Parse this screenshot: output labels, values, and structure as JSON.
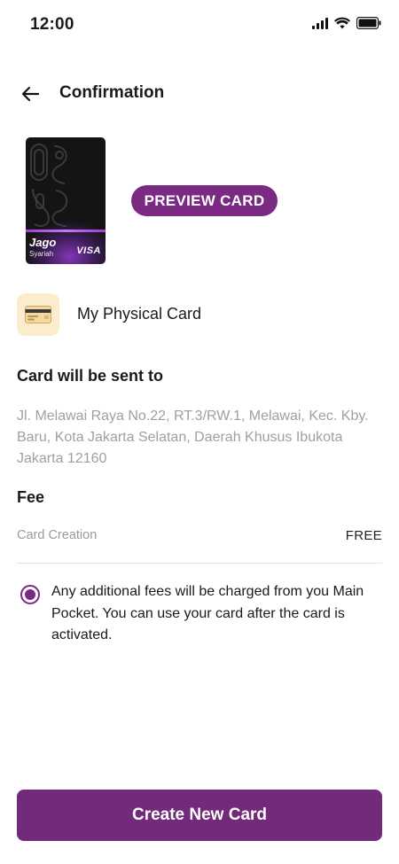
{
  "status_bar": {
    "time": "12:00",
    "icons": [
      "signal-icon",
      "wifi-icon",
      "battery-icon"
    ]
  },
  "header": {
    "back_icon": "back-arrow-icon",
    "title": "Confirmation"
  },
  "card": {
    "brand": "Jago",
    "sub_brand": "Syariah",
    "network": "VISA",
    "preview_label": "PREVIEW CARD"
  },
  "physical_card": {
    "icon": "credit-card-icon",
    "label": "My Physical Card"
  },
  "delivery": {
    "title": "Card will be sent to",
    "address": "Jl. Melawai Raya No.22, RT.3/RW.1, Melawai, Kec. Kby. Baru, Kota Jakarta Selatan, Daerah Khusus Ibukota Jakarta 12160"
  },
  "fee": {
    "title": "Fee",
    "items": [
      {
        "label": "Card Creation",
        "value": "FREE"
      }
    ]
  },
  "notice": {
    "checked": true,
    "text": "Any additional fees will be charged from you Main Pocket. You  can use your card after the card is activated."
  },
  "actions": {
    "create_label": "Create New Card"
  },
  "colors": {
    "primary": "#722a7a",
    "card_icon_bg": "#fbeccb",
    "muted_text": "#a0a0a0"
  }
}
